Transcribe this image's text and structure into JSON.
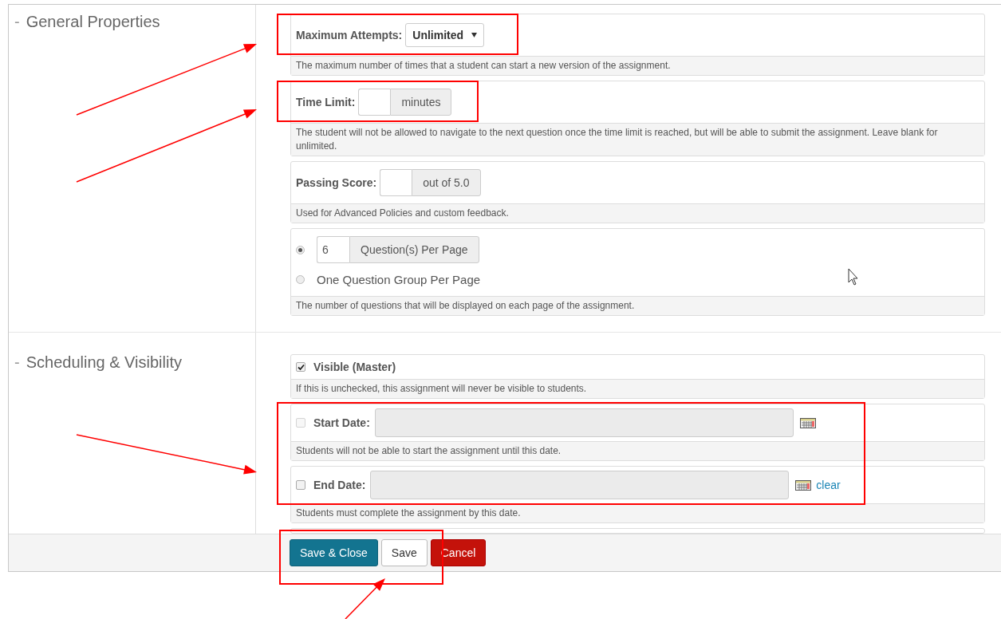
{
  "sections": [
    {
      "toggle": "-",
      "title": "General Properties",
      "fields": [
        {
          "kind": "select",
          "label": "Maximum Attempts:",
          "value": "Unlimited",
          "help": "The maximum number of times that a student can start a new version of the assignment."
        },
        {
          "kind": "addon",
          "label": "Time Limit:",
          "addon": "minutes",
          "help": "The student will not be allowed to navigate to the next question once the time limit is reached, but will be able to submit the assignment. Leave blank for unlimited."
        },
        {
          "kind": "addon",
          "label": "Passing Score:",
          "addon": "out of 5.0",
          "help": "Used for Advanced Policies and custom feedback."
        },
        {
          "kind": "radios",
          "options": [
            {
              "kind": "addon",
              "value": "6",
              "addon": "Question(s) Per Page",
              "selected": true
            },
            {
              "kind": "text",
              "label": "One Question Group Per Page",
              "selected": false
            }
          ],
          "help": "The number of questions that will be displayed on each page of the assignment."
        }
      ]
    },
    {
      "toggle": "-",
      "title": "Scheduling & Visibility",
      "fields": [
        {
          "kind": "checkbox",
          "label": "Visible (Master)",
          "checked": true,
          "help": "If this is unchecked, this assignment will never be visible to students."
        },
        {
          "kind": "date",
          "label": "Start Date:",
          "checked": false,
          "disabled": true,
          "help": "Students will not be able to start the assignment until this date."
        },
        {
          "kind": "date",
          "label": "End Date:",
          "checked": false,
          "disabled": false,
          "clear": "clear",
          "help": "Students must complete the assignment by this date."
        }
      ]
    }
  ],
  "buttons": [
    {
      "label": "Save & Close",
      "kind": "primary"
    },
    {
      "label": "Save",
      "kind": "default"
    },
    {
      "label": "Cancel",
      "kind": "danger"
    }
  ]
}
